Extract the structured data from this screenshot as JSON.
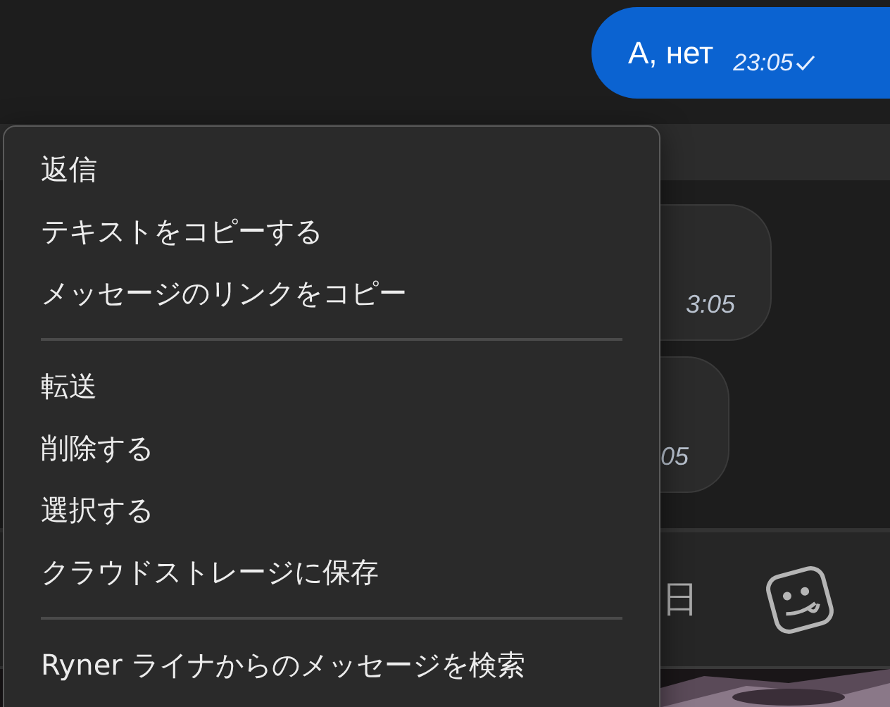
{
  "messages": [
    {
      "kind": "outgoing",
      "text": "А, нет",
      "time": "23:05"
    },
    {
      "kind": "incoming",
      "time": "3:05"
    },
    {
      "kind": "incoming",
      "time": "05"
    }
  ],
  "composer": {
    "text": "日"
  },
  "context_menu": {
    "groups": [
      [
        "返信",
        "テキストをコピーする",
        "メッセージのリンクをコピー"
      ],
      [
        "転送",
        "削除する",
        "選択する",
        "クラウドストレージに保存"
      ],
      [
        "Ryner ライナからのメッセージを検索"
      ]
    ]
  }
}
